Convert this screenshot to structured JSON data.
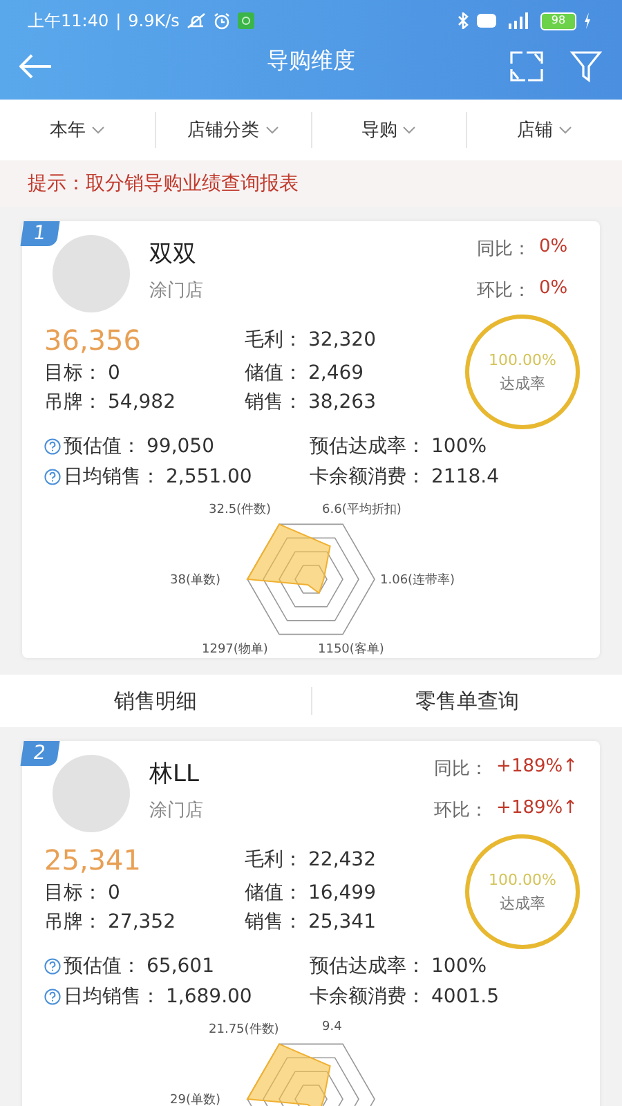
{
  "status_bar": {
    "time": "上午11:40",
    "separator": "|",
    "speed": "9.9K/s",
    "battery": "98"
  },
  "nav": {
    "title": "导购维度"
  },
  "filters": [
    {
      "label": "本年"
    },
    {
      "label": "店铺分类"
    },
    {
      "label": "导购"
    },
    {
      "label": "店铺"
    }
  ],
  "hint": "提示：取分销导购业绩查询报表",
  "cards": [
    {
      "rank": "1",
      "name": "双双",
      "store": "涂门店",
      "yoy_label": "同比：",
      "yoy": "0%",
      "mom_label": "环比：",
      "mom": "0%",
      "total": "36,356",
      "stats": [
        [
          "毛利：",
          "32,320"
        ],
        [
          "目标：",
          "0"
        ],
        [
          "储值：",
          "2,469"
        ],
        [
          "吊牌：",
          "54,982"
        ],
        [
          "销售：",
          "38,263"
        ]
      ],
      "ring": {
        "level": 1,
        "value": "100.00%",
        "label": "达成率"
      },
      "extra": [
        {
          "label": "预估值：",
          "value": "99,050",
          "help": true
        },
        {
          "label": "预估达成率：",
          "value": "100%",
          "help": false
        },
        {
          "label": "日均销售：",
          "value": "2,551.00",
          "help": true
        },
        {
          "label": "卡余额消费：",
          "value": "2118.4",
          "help": false
        }
      ],
      "radar_labels": [
        {
          "kind": "top-left",
          "text": "32.5(件数)"
        },
        {
          "kind": "top-right",
          "text": "6.6(平均折扣)"
        },
        {
          "kind": "right",
          "text": "1.06(连带率)"
        },
        {
          "kind": "bottom-right",
          "text": "1150(客单)"
        },
        {
          "kind": "bottom-left",
          "text": "1297(物单)"
        },
        {
          "kind": "left",
          "text": "38(单数)"
        }
      ]
    },
    {
      "rank": "2",
      "name": "林LL",
      "store": "涂门店",
      "yoy_label": "同比：",
      "yoy": "+189%↑",
      "mom_label": "环比：",
      "mom": "+189%↑",
      "total": "25,341",
      "stats": [
        [
          "毛利：",
          "22,432"
        ],
        [
          "目标：",
          "0"
        ],
        [
          "储值：",
          "16,499"
        ],
        [
          "吊牌：",
          "27,352"
        ],
        [
          "销售：",
          "25,341"
        ]
      ],
      "ring": {
        "level": 1,
        "value": "100.00%",
        "label": "达成率"
      },
      "extra": [
        {
          "label": "预估值：",
          "value": "65,601",
          "help": true
        },
        {
          "label": "预估达成率：",
          "value": "100%",
          "help": false
        },
        {
          "label": "日均销售：",
          "value": "1,689.00",
          "help": true
        },
        {
          "label": "卡余额消费：",
          "value": "4001.5",
          "help": false
        }
      ],
      "radar_labels": [
        {
          "kind": "top-left",
          "text": "21.75(件数)"
        },
        {
          "kind": "top-right",
          "text": "9.4"
        },
        {
          "kind": "left",
          "text": "29(单数)"
        }
      ]
    }
  ],
  "actions": [
    {
      "label": "销售明细"
    },
    {
      "label": "零售单查询"
    }
  ]
}
